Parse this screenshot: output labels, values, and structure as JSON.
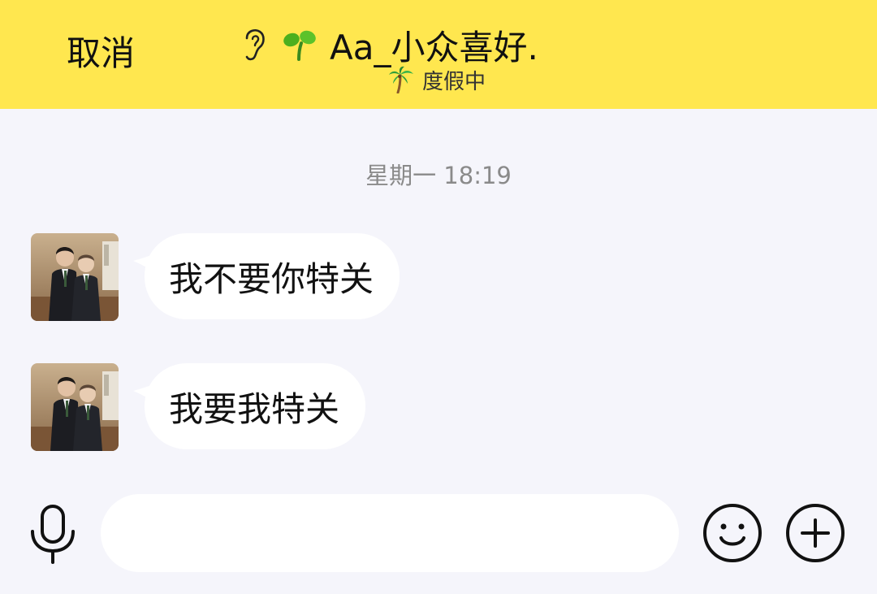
{
  "header": {
    "cancel_label": "取消",
    "title": "Aa_小众喜好.",
    "title_icons": [
      "ear-icon",
      "sprout-icon"
    ],
    "status_icon": "palm-tree-icon",
    "status_text": "度假中",
    "background_color": "#ffe74f"
  },
  "chat": {
    "timestamp": "星期一 18:19",
    "messages": [
      {
        "sender": "other",
        "avatar": "avatar-photo",
        "text": "我不要你特关"
      },
      {
        "sender": "other",
        "avatar": "avatar-photo",
        "text": "我要我特关"
      }
    ]
  },
  "input_bar": {
    "placeholder": "",
    "value": "",
    "left_icon": "microphone-icon",
    "right_icons": [
      "emoji-icon",
      "plus-icon"
    ]
  }
}
